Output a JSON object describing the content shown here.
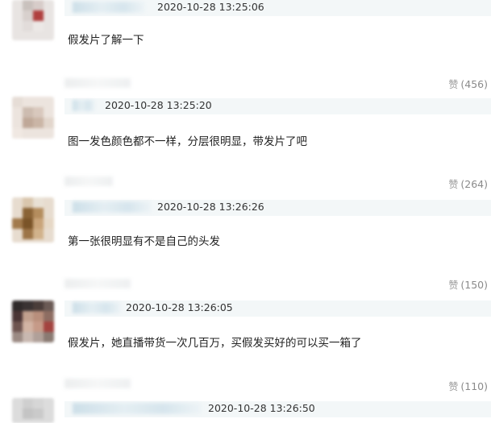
{
  "comments": [
    {
      "timestamp": "2020-10-28 13:25:06",
      "text": "假发片了解一下"
    },
    {
      "timestamp": "2020-10-28 13:25:20",
      "text": "图一发色颜色都不一样，分层很明显，带发片了吧"
    },
    {
      "timestamp": "2020-10-28 13:26:26",
      "text": "第一张很明显有不是自己的头发"
    },
    {
      "timestamp": "2020-10-28 13:26:05",
      "text": "假发片，她直播带货一次几百万，买假发买好的可以买一箱了"
    },
    {
      "timestamp": "2020-10-28 13:26:50",
      "text": ""
    }
  ],
  "likes": [
    {
      "icon": "thumbs-up-icon",
      "label": "赞",
      "count": "(456)"
    },
    {
      "icon": "thumbs-up-icon",
      "label": "赞",
      "count": "(264)"
    },
    {
      "icon": "thumbs-up-icon",
      "label": "赞",
      "count": "(150)"
    },
    {
      "icon": "thumbs-up-icon",
      "label": "赞",
      "count": "(110)"
    }
  ]
}
